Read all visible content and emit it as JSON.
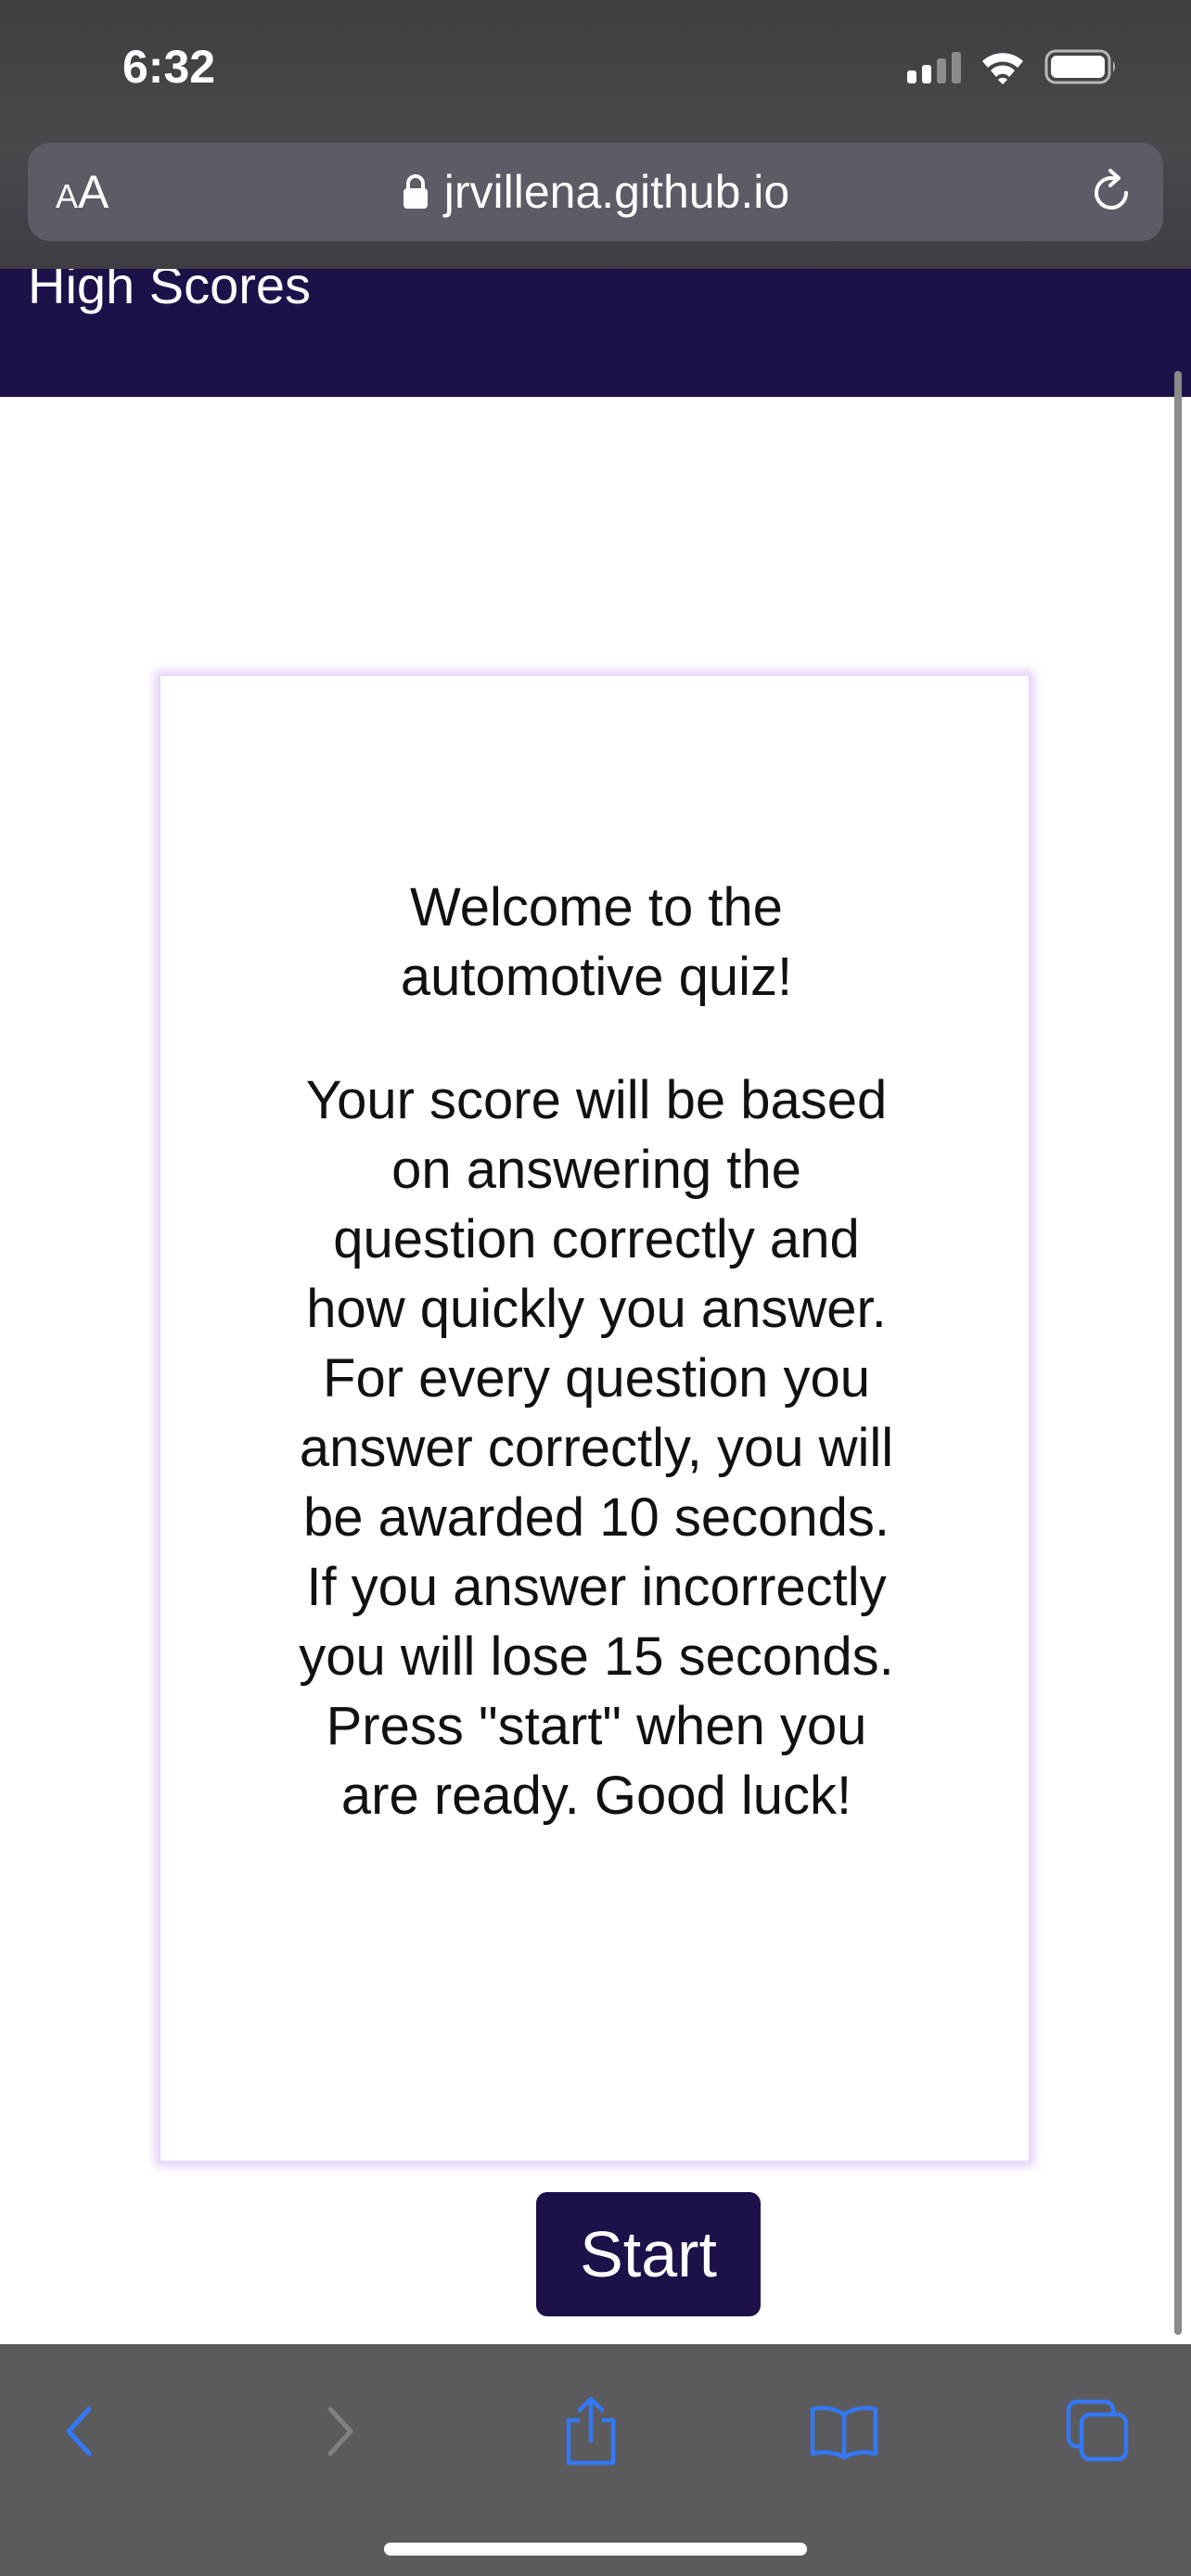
{
  "status_bar": {
    "time": "6:32",
    "icons": [
      "cellular-signal-icon",
      "wifi-icon",
      "battery-icon"
    ]
  },
  "browser": {
    "text_size_label": {
      "small": "A",
      "large": "A"
    },
    "url": "jrvillena.github.io",
    "url_icons": [
      "lock-icon",
      "reload-icon"
    ],
    "toolbar_icons": [
      "back-icon",
      "forward-icon",
      "share-icon",
      "bookmarks-icon",
      "tabs-icon"
    ],
    "accent_color": "#3478f6"
  },
  "header": {
    "high_scores_link": "High Scores",
    "background_color": "#1e1149"
  },
  "quiz": {
    "welcome": "Welcome to the automotive quiz!",
    "rules": "Your score will be based on answering the question correctly and how quickly you answer. For every question you answer correctly, you will be awarded 10 seconds. If you answer incorrectly you will lose 15 seconds. Press \"start\" when you are ready. Good luck!",
    "start_label": "Start",
    "button_color": "#1e1149"
  }
}
